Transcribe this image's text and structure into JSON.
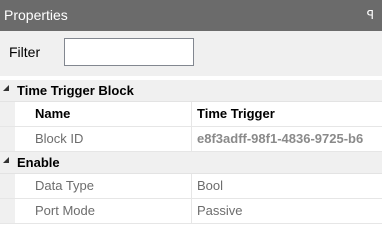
{
  "panel": {
    "title": "Properties",
    "pin_glyph": "ꟼ"
  },
  "filter": {
    "label": "Filter",
    "value": "",
    "placeholder": ""
  },
  "categories": [
    {
      "label": "Time Trigger Block",
      "properties": [
        {
          "name": "Name",
          "value": "Time Trigger"
        },
        {
          "name": "Block ID",
          "value": "e8f3adff-98f1-4836-9725-b6"
        }
      ]
    },
    {
      "label": "Enable",
      "properties": [
        {
          "name": "Data Type",
          "value": "Bool"
        },
        {
          "name": "Port Mode",
          "value": "Passive"
        }
      ]
    }
  ],
  "icons": {
    "pin": "pin-icon",
    "collapse": "collapse-triangle-icon"
  },
  "colors": {
    "titlebar_bg": "#6b6b6b",
    "toolbar_bg": "#f0f0f0",
    "category_bg": "#f0f0f0",
    "muted_text": "#6d6d6d"
  }
}
